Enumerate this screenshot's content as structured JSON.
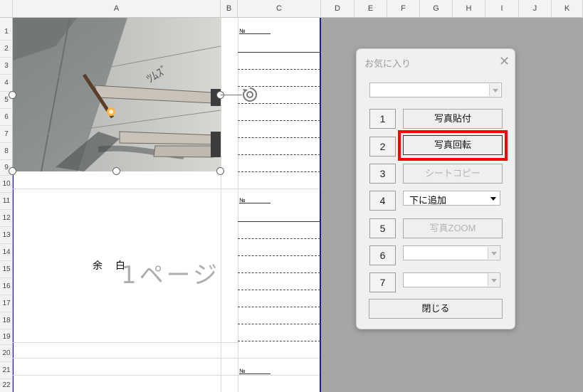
{
  "columns": [
    "A",
    "B",
    "C",
    "D",
    "E",
    "F",
    "G",
    "H",
    "I",
    "J",
    "K"
  ],
  "rows": [
    "1",
    "2",
    "3",
    "4",
    "5",
    "6",
    "7",
    "8",
    "9",
    "10",
    "11",
    "12",
    "13",
    "14",
    "15",
    "16",
    "17",
    "18",
    "19",
    "20",
    "21",
    "22"
  ],
  "cells": {
    "no_label_1": "№",
    "no_label_2": "№",
    "no_label_3": "№",
    "margin_text": "余　白",
    "page_watermark": "1ページ"
  },
  "dialog": {
    "title": "お気に入り",
    "close_symbol": "✕",
    "top_dropdown_value": "",
    "buttons": [
      {
        "num": "1",
        "label": "写真貼付",
        "enabled": true
      },
      {
        "num": "2",
        "label": "写真回転",
        "enabled": true,
        "highlighted": true
      },
      {
        "num": "3",
        "label": "シートコピー",
        "enabled": false
      },
      {
        "num": "4",
        "label": "下に追加",
        "type": "dropdown"
      },
      {
        "num": "5",
        "label": "写真ZOOM",
        "enabled": false
      },
      {
        "num": "6",
        "label": "",
        "type": "dropdown"
      },
      {
        "num": "7",
        "label": "",
        "type": "dropdown"
      }
    ],
    "close_button": "閉じる"
  },
  "colors": {
    "highlight": "#ff0000",
    "page_border": "#1a1aa6",
    "background": "#a6a6a6"
  }
}
